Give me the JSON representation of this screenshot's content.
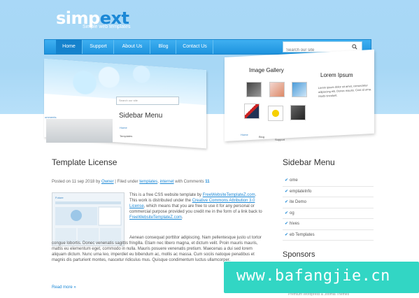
{
  "logo": {
    "part1": "simp",
    "part2": "ext",
    "tagline": "Simple web templates"
  },
  "nav": {
    "items": [
      "Home",
      "Support",
      "About Us",
      "Blog",
      "Contact Us"
    ],
    "active_index": 0,
    "search_placeholder": "Search our site"
  },
  "preview": {
    "search_placeholder": "Search our site",
    "sidebar_title": "Sidebar Menu",
    "sidebar_links": [
      "Home",
      "Templates"
    ],
    "comments_link": "omments",
    "gallery_title": "Image Gallery",
    "lorem_title": "Lorem Ipsum",
    "lorem_text": "Lorem ipsum dolor sit amet, consectetur adipiscing elit. Donec mauris. Cras id urna. Morbi tincidunt.",
    "footer_links": [
      "Home",
      "Blog",
      "Support"
    ]
  },
  "post": {
    "title": "Template License",
    "meta_prefix": "Posted on 11 sep 2018 by",
    "author": "Owner",
    "filed_under": "| Filed under",
    "cat1": "templates",
    "cat2": "internet",
    "with_comments": "with Comments",
    "comments_count": "11",
    "p1_a": "This is a free CSS website template by ",
    "p1_link1": "FreeWebsiteTemplateZ.com",
    "p1_b": ". This work is distributed under the ",
    "p1_link2": "Creative Commons Attribution 3.0 License",
    "p1_c": ", which means that you are free to use it for any personal or commercial purpose provided you credit me in the form of a link back to ",
    "p1_link3": "FreeWebsiteTemplateZ.com",
    "p1_d": ".",
    "p2": "Aenean consequat porttitor adipiscing. Nam pellentesque justo ut tortor congue lobortis. Donec venenatis sagittis fringilla. Etiam nec libero magna, et dictum velit. Proin mauris mauris, mattis eu elementum eget, commodo in nulla. Mauris posuere venenatis pretium. Maecenas a dui sed lorem aliquam dictum. Nunc urna leo, imperdiet eu bibendum ac, mollis ac massa. Cum sociis natoque penatibus et magnis dis parturient montes, nascetur ridiculus mus. Quisque condimentum luctus ullamcorper.",
    "read_more": "Read more »"
  },
  "sidebar": {
    "title": "Sidebar Menu",
    "items": [
      "ome",
      "emplateInfo",
      "ite Demo",
      "og",
      "hives",
      "eb Templates"
    ],
    "sponsors_title": "Sponsors",
    "sponsors_sub": "Premium Wordpress & Joomla Themes"
  },
  "watermark": "www.bafangjie.cn",
  "colors": {
    "accent": "#1b88d6",
    "nav": "#2aa3ea",
    "sky": "#a9d8f7",
    "watermark": "#32d6c4"
  }
}
